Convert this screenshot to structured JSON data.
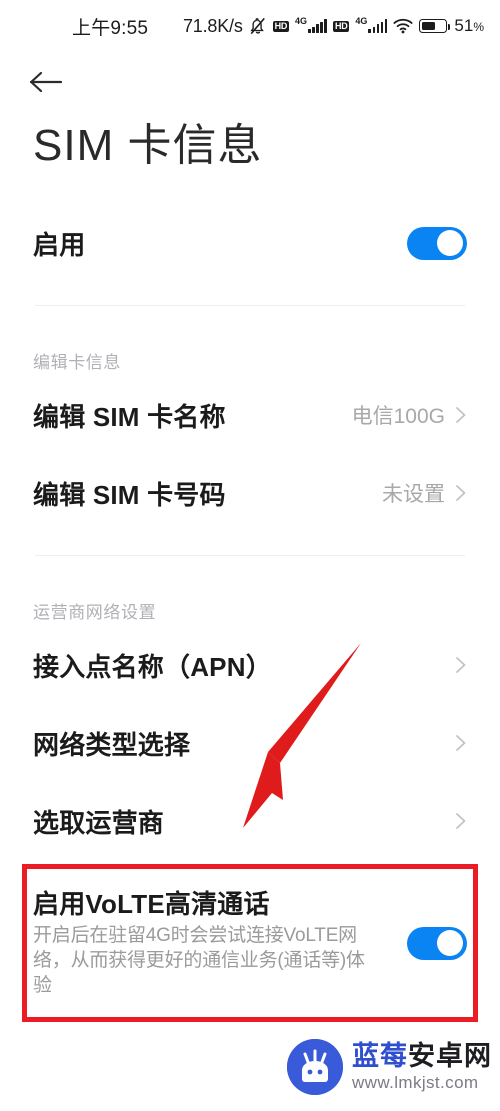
{
  "status_bar": {
    "clock": "上午9:55",
    "net_speed": "71.8K/s",
    "mute_icon": "mute-bell-icon",
    "hd_badge_1": "HD",
    "sim1_network": "4G",
    "hd_badge_2": "HD",
    "sim2_network": "4G",
    "wifi_icon": "wifi-icon",
    "battery_percent": "51",
    "battery_percent_symbol": "%",
    "battery_level": 51
  },
  "nav": {
    "back_icon": "back-arrow-icon",
    "title": "SIM 卡信息"
  },
  "enable_row": {
    "label": "启用",
    "toggle_on": true
  },
  "section_card": {
    "header": "编辑卡信息",
    "rows": [
      {
        "label": "编辑 SIM 卡名称",
        "value": "电信100G",
        "chevron": "chevron-right-icon"
      },
      {
        "label": "编辑 SIM 卡号码",
        "value": "未设置",
        "chevron": "chevron-right-icon"
      }
    ]
  },
  "section_carrier": {
    "header": "运营商网络设置",
    "rows": [
      {
        "label": "接入点名称（APN）",
        "value": "",
        "chevron": "chevron-right-icon"
      },
      {
        "label": "网络类型选择",
        "value": "",
        "chevron": "chevron-right-icon"
      },
      {
        "label": "选取运营商",
        "value": "",
        "chevron": "chevron-right-icon"
      }
    ]
  },
  "volte": {
    "title": "启用VoLTE高清通话",
    "description": "开启后在驻留4G时会尝试连接VoLTE网络，从而获得更好的通信业务(通话等)体验",
    "toggle_on": true
  },
  "annotations": {
    "highlight_color": "#ec1c24",
    "arrow": "red-arrow-annotation",
    "box": "red-highlight-box"
  },
  "watermark": {
    "brand_first": "蓝莓",
    "brand_second": "安卓网",
    "url": "www.lmkjst.com",
    "logo_icon": "android-robot-logo"
  },
  "colors": {
    "accent_blue": "#0b84f3",
    "annotation_red": "#ec1c24",
    "text_primary": "#1b1b1b",
    "text_secondary": "#a8a8a8",
    "section_header": "#b0b0b6"
  }
}
